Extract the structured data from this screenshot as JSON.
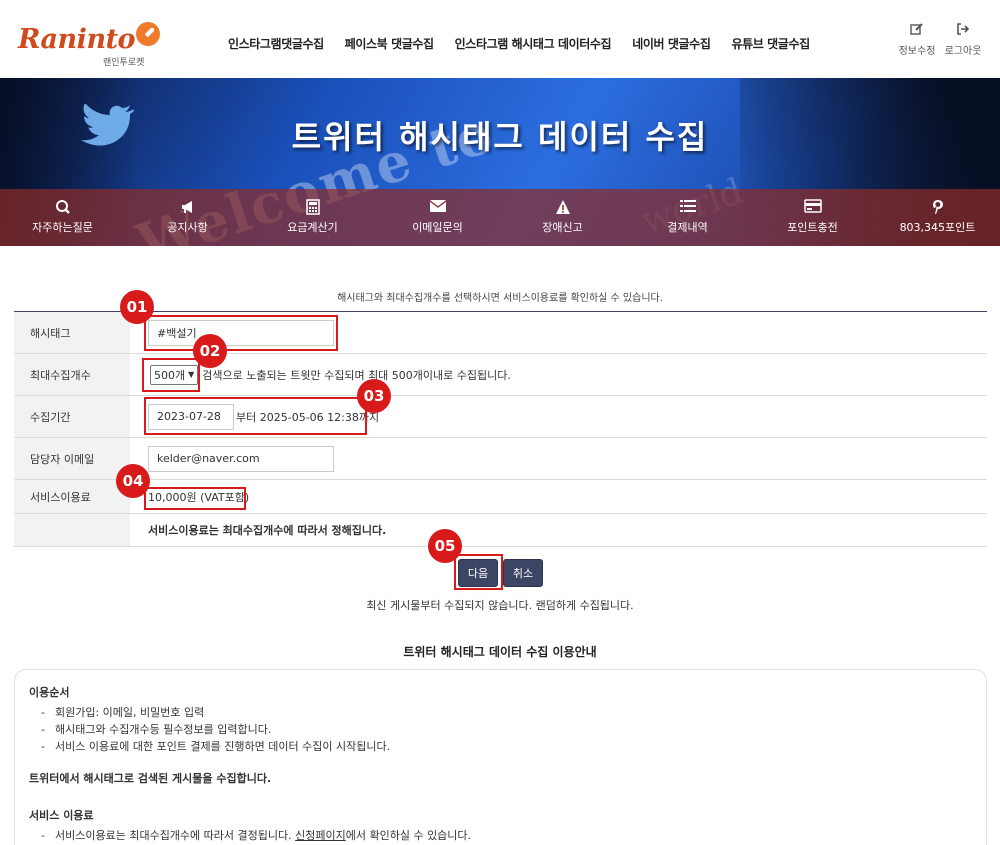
{
  "header": {
    "logo_text": "Raninto",
    "logo_sub": "랜인투로켓",
    "nav": [
      "인스타그램댓글수집",
      "페이스북 댓글수집",
      "인스타그램 해시태그 데이터수집",
      "네이버 댓글수집",
      "유튜브 댓글수집"
    ],
    "actions": [
      {
        "label": "정보수정",
        "icon": "edit-icon"
      },
      {
        "label": "로그아웃",
        "icon": "logout-icon"
      }
    ]
  },
  "banner": {
    "title": "트위터 해시태그 데이터 수집",
    "bg_word": "Welcome to",
    "bg_word2": "world",
    "quick": [
      {
        "label": "자주하는질문",
        "icon": "search-icon"
      },
      {
        "label": "공지사항",
        "icon": "megaphone-icon"
      },
      {
        "label": "요금계산기",
        "icon": "calculator-icon"
      },
      {
        "label": "이메일문의",
        "icon": "mail-icon"
      },
      {
        "label": "장애신고",
        "icon": "warning-icon"
      },
      {
        "label": "결제내역",
        "icon": "list-icon"
      },
      {
        "label": "포인트충전",
        "icon": "card-icon"
      },
      {
        "label": "803,345포인트",
        "icon": "pinterest-icon"
      }
    ]
  },
  "form": {
    "intro": "해시태그와 최대수집개수를 선택하시면 서비스이용료를 확인하실 수 있습니다.",
    "hashtag_label": "해시태그",
    "hashtag_value": "#백설기",
    "max_label": "최대수집개수",
    "max_selected": "500개",
    "max_note": "검색으로 노출되는 트윗만 수집되며 최대 500개이내로 수집됩니다.",
    "period_label": "수집기간",
    "period_start": "2023-07-28",
    "period_text": "부터 2025-05-06 12:38까지",
    "email_label": "담당자 이메일",
    "email_value": "kelder@naver.com",
    "fee_label": "서비스이용료",
    "fee_value": "10,000원 (VAT포함)",
    "fee_note": "서비스이용료는 최대수집개수에 따라서 정해집니다."
  },
  "badges": [
    "01",
    "02",
    "03",
    "04",
    "05"
  ],
  "buttons": {
    "next": "다음",
    "cancel": "취소"
  },
  "note": "최신 게시물부터 수집되지 않습니다. 랜덤하게 수집됩니다.",
  "guide": {
    "title": "트위터 해시태그 데이터 수집 이용안내",
    "steps_heading": "이용순서",
    "steps": [
      "회원가입: 이메일, 비밀번호 입력",
      "해시태그와 수집개수등 필수정보를 입력합니다.",
      "서비스 이용료에 대한 포인트 결제를 진행하면 데이터 수집이 시작됩니다."
    ],
    "summary": "트위터에서 해시태그로 검색된 게시물을 수집합니다.",
    "fee_heading": "서비스 이용료",
    "fee_line_pre": "서비스이용료는 최대수집개수에 따라서 결정됩니다. ",
    "fee_line_link": "신청페이지",
    "fee_line_post": "에서 확인하실 수 있습니다."
  },
  "colors": {
    "accent_red": "#d71a1a",
    "button_navy": "#3c4563",
    "logo_orange": "#d04a1e"
  }
}
